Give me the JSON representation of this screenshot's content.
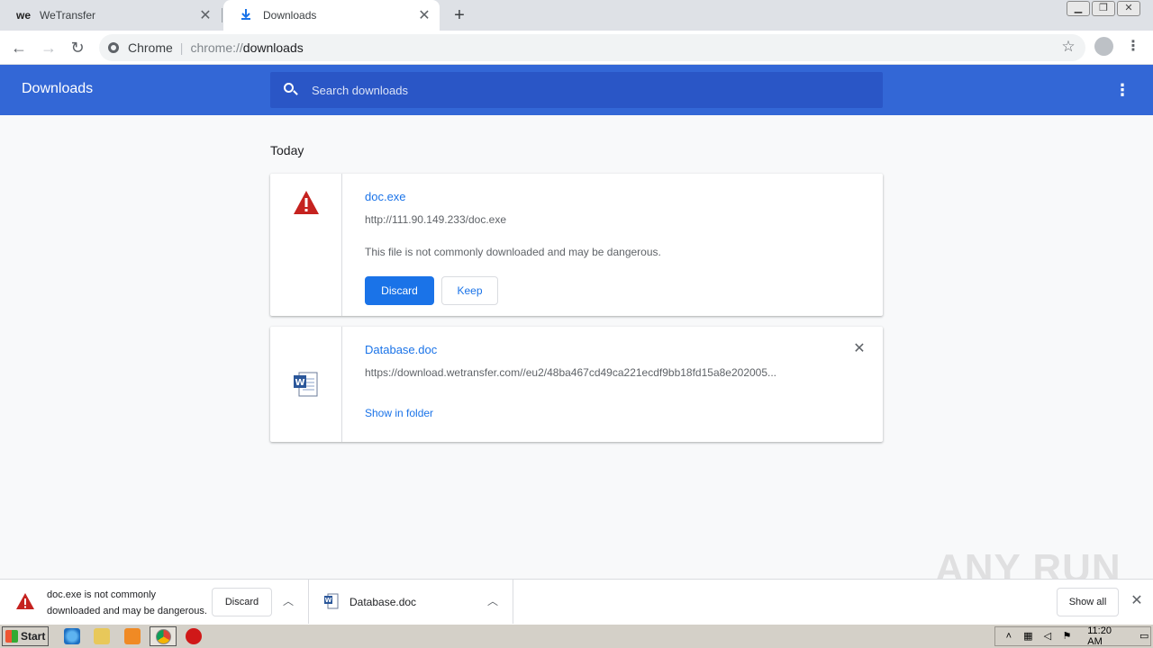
{
  "tabs": [
    {
      "title": "WeTransfer",
      "favicon": "we",
      "active": false
    },
    {
      "title": "Downloads",
      "favicon": "download-icon",
      "active": true
    }
  ],
  "toolbar": {
    "site_chip": "Chrome",
    "url_scheme": "chrome://",
    "url_host": "downloads"
  },
  "header": {
    "title": "Downloads",
    "search_placeholder": "Search downloads"
  },
  "section_date": "Today",
  "downloads": [
    {
      "name": "doc.exe",
      "url": "http://111.90.149.233/doc.exe",
      "warning": "This file is not commonly downloaded and may be dangerous.",
      "discard_label": "Discard",
      "keep_label": "Keep",
      "icon": "warning-icon"
    },
    {
      "name": "Database.doc",
      "url": "https://download.wetransfer.com//eu2/48ba467cd49ca221ecdf9bb18fd15a8e202005...",
      "show_in_folder": "Show in folder",
      "icon": "word-doc-icon"
    }
  ],
  "download_bar": {
    "item1_message": "doc.exe is not commonly downloaded and may be dangerous.",
    "item1_discard": "Discard",
    "item2_name": "Database.doc",
    "show_all": "Show all"
  },
  "watermark": "ANY RUN",
  "taskbar": {
    "start_label": "Start",
    "clock": "11:20 AM"
  },
  "colors": {
    "header_blue": "#3367d6",
    "search_blue": "#2a56c6",
    "link_blue": "#1a73e8",
    "warning_red": "#c5221f"
  }
}
